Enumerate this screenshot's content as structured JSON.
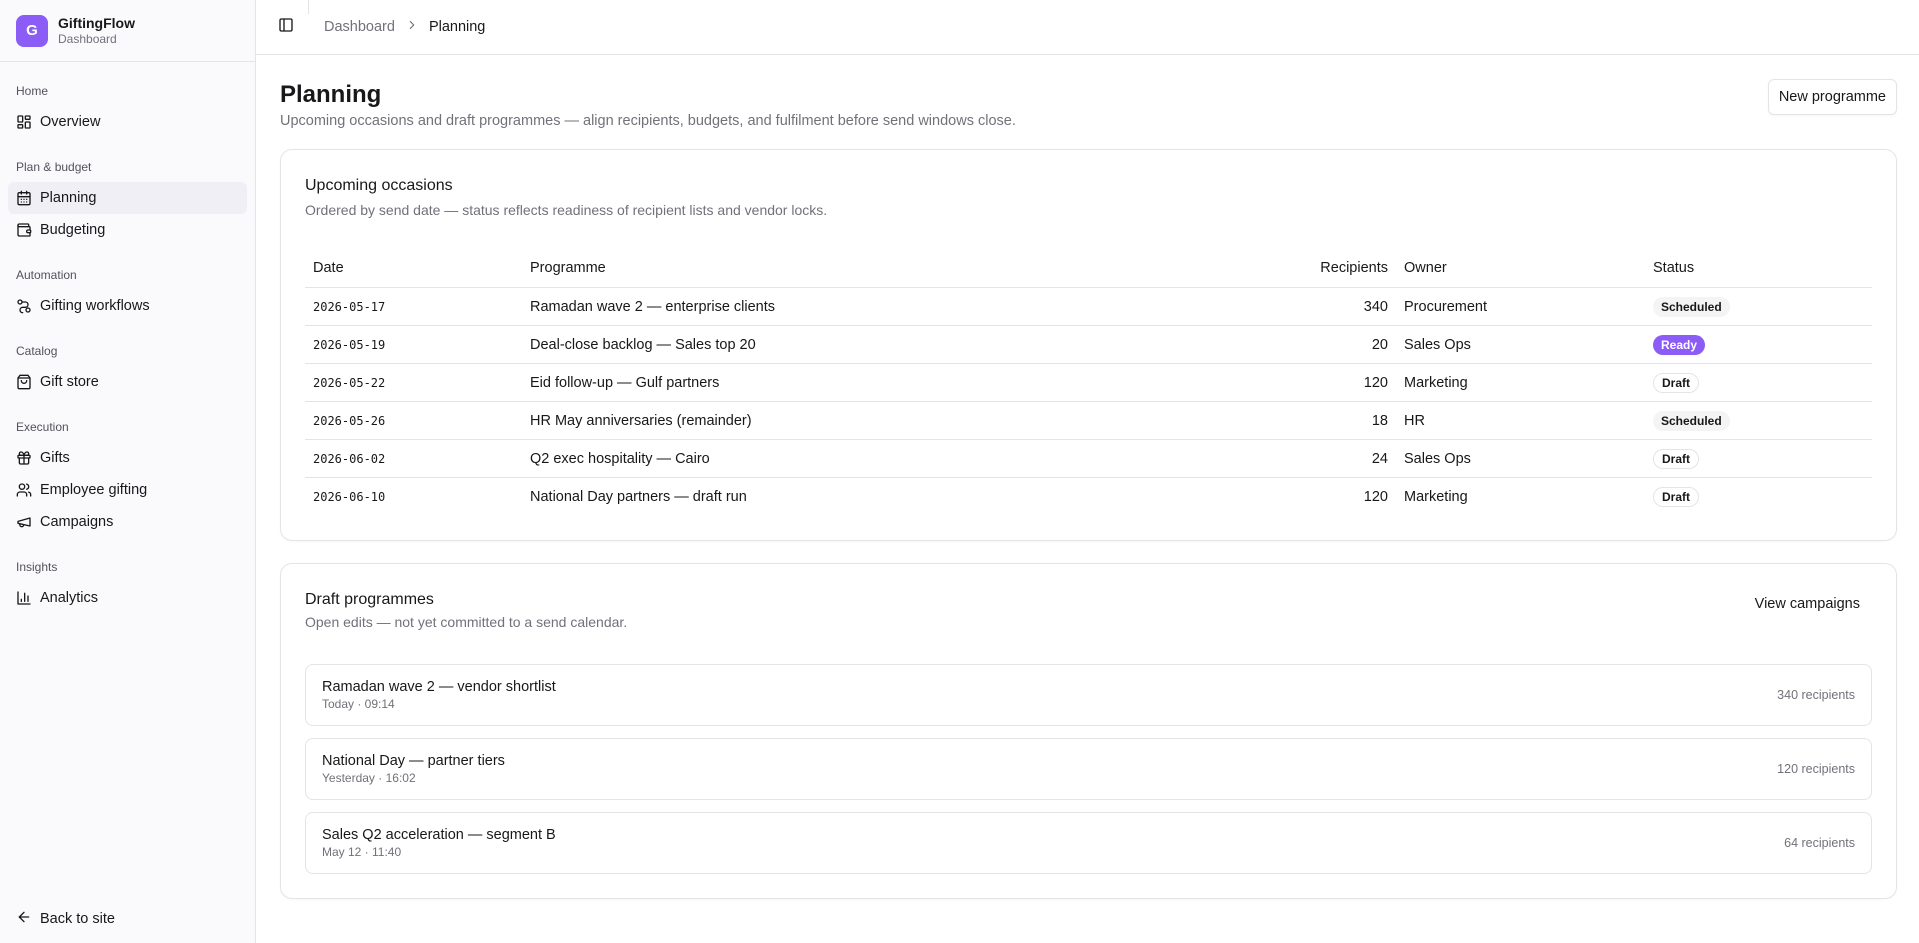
{
  "brand": {
    "initial": "G",
    "name": "GiftingFlow",
    "subtitle": "Dashboard"
  },
  "sidebar": {
    "groups": [
      {
        "label": "Home",
        "items": [
          {
            "label": "Overview",
            "icon": "layout-grid-icon"
          }
        ]
      },
      {
        "label": "Plan & budget",
        "items": [
          {
            "label": "Planning",
            "icon": "calendar-icon",
            "active": true
          },
          {
            "label": "Budgeting",
            "icon": "wallet-icon"
          }
        ]
      },
      {
        "label": "Automation",
        "items": [
          {
            "label": "Gifting workflows",
            "icon": "workflow-icon"
          }
        ]
      },
      {
        "label": "Catalog",
        "items": [
          {
            "label": "Gift store",
            "icon": "shopping-bag-icon"
          }
        ]
      },
      {
        "label": "Execution",
        "items": [
          {
            "label": "Gifts",
            "icon": "gift-icon"
          },
          {
            "label": "Employee gifting",
            "icon": "users-icon"
          },
          {
            "label": "Campaigns",
            "icon": "megaphone-icon"
          }
        ]
      },
      {
        "label": "Insights",
        "items": [
          {
            "label": "Analytics",
            "icon": "bar-chart-icon"
          }
        ]
      }
    ],
    "footer": {
      "label": "Back to site",
      "icon": "arrow-left-icon"
    }
  },
  "topbar": {
    "toggle_icon": "panel-left-icon",
    "breadcrumb": [
      "Dashboard",
      "Planning"
    ]
  },
  "page": {
    "title": "Planning",
    "subtitle": "Upcoming occasions and draft programmes — align recipients, budgets, and fulfilment before send windows close.",
    "new_button": "New programme"
  },
  "occasions": {
    "title": "Upcoming occasions",
    "subtitle": "Ordered by send date — status reflects readiness of recipient lists and vendor locks.",
    "columns": [
      "Date",
      "Programme",
      "Recipients",
      "Owner",
      "Status"
    ],
    "rows": [
      {
        "date": "2026-05-17",
        "programme": "Ramadan wave 2 — enterprise clients",
        "recipients": "340",
        "owner": "Procurement",
        "status": "Scheduled",
        "status_kind": "scheduled"
      },
      {
        "date": "2026-05-19",
        "programme": "Deal-close backlog — Sales top 20",
        "recipients": "20",
        "owner": "Sales Ops",
        "status": "Ready",
        "status_kind": "ready"
      },
      {
        "date": "2026-05-22",
        "programme": "Eid follow-up — Gulf partners",
        "recipients": "120",
        "owner": "Marketing",
        "status": "Draft",
        "status_kind": "draft"
      },
      {
        "date": "2026-05-26",
        "programme": "HR May anniversaries (remainder)",
        "recipients": "18",
        "owner": "HR",
        "status": "Scheduled",
        "status_kind": "scheduled"
      },
      {
        "date": "2026-06-02",
        "programme": "Q2 exec hospitality — Cairo",
        "recipients": "24",
        "owner": "Sales Ops",
        "status": "Draft",
        "status_kind": "draft"
      },
      {
        "date": "2026-06-10",
        "programme": "National Day partners — draft run",
        "recipients": "120",
        "owner": "Marketing",
        "status": "Draft",
        "status_kind": "draft"
      }
    ]
  },
  "drafts": {
    "title": "Draft programmes",
    "subtitle": "Open edits — not yet committed to a send calendar.",
    "action": "View campaigns",
    "items": [
      {
        "name": "Ramadan wave 2 — vendor shortlist",
        "time": "Today · 09:14",
        "count": "340 recipients"
      },
      {
        "name": "National Day — partner tiers",
        "time": "Yesterday · 16:02",
        "count": "120 recipients"
      },
      {
        "name": "Sales Q2 acceleration — segment B",
        "time": "May 12 · 11:40",
        "count": "64 recipients"
      }
    ]
  },
  "colors": {
    "accent": "#8b5cf6",
    "border": "#e4e4e7",
    "muted": "#71717a"
  }
}
